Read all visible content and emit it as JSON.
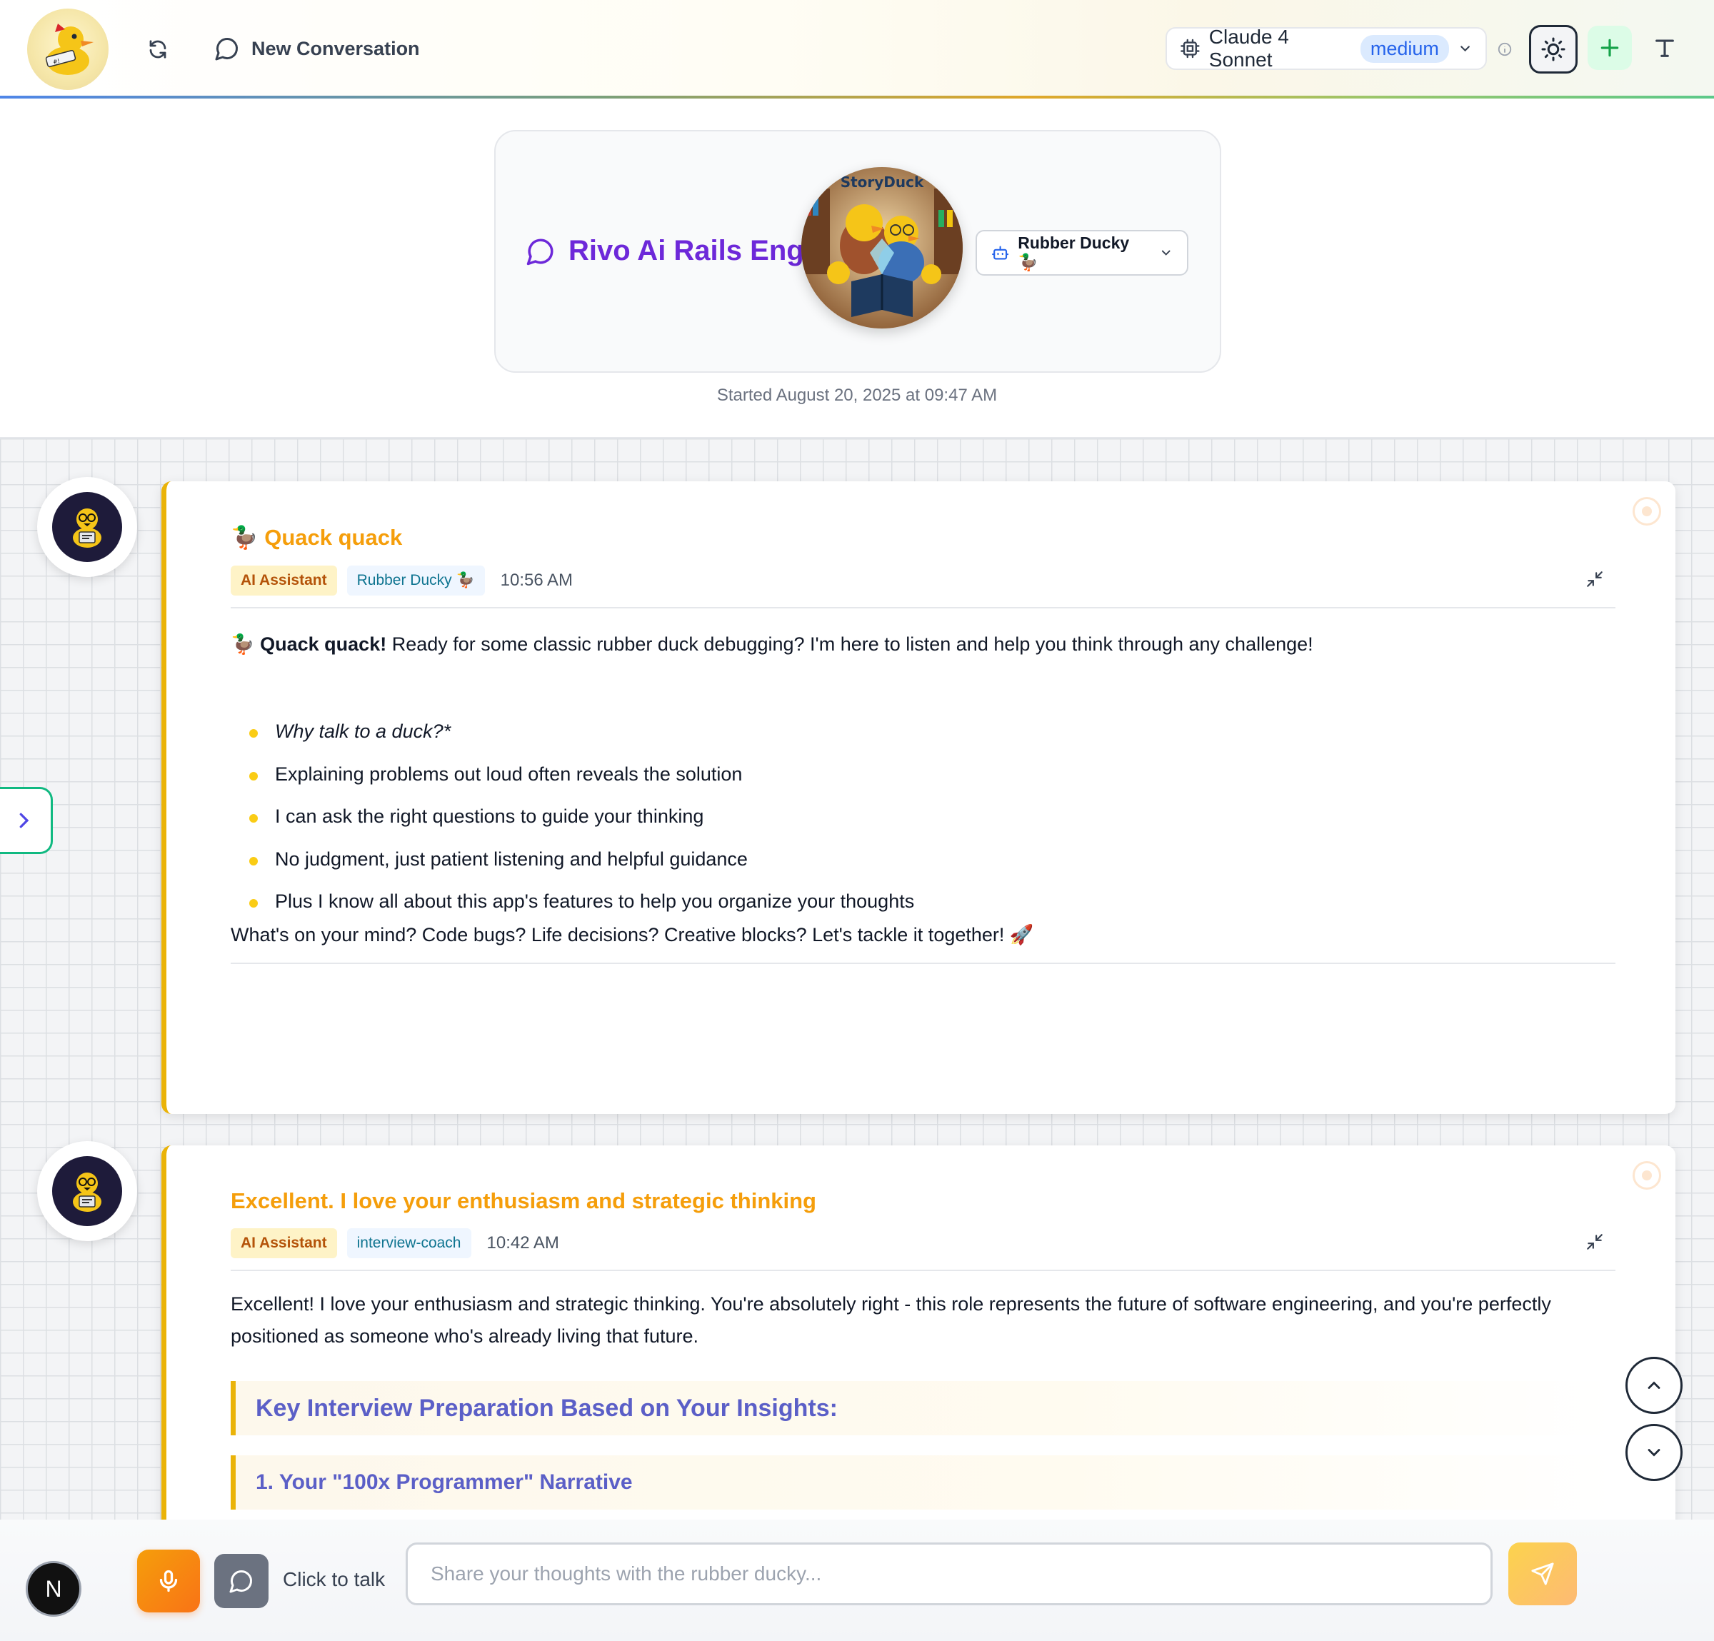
{
  "header": {
    "new_conversation_label": "New Conversation",
    "model_name": "Claude 4 Sonnet",
    "model_effort": "medium"
  },
  "conversation": {
    "title": "Rivo Ai Rails Eng",
    "avatar_label": "StoryDuck",
    "persona_selected": "Rubber Ducky 🦆",
    "started": "Started August 20, 2025 at 09:47 AM"
  },
  "messages": [
    {
      "title": "🦆 Quack quack",
      "role_tag": "AI Assistant",
      "persona_tag": "Rubber Ducky 🦆",
      "time": "10:56 AM",
      "intro_bold": "Quack quack!",
      "intro_emoji": "🦆",
      "intro_rest": " Ready for some classic rubber duck debugging? I'm here to listen and help you think through any challenge!",
      "bullets": [
        "Why talk to a duck?*",
        "Explaining problems out loud often reveals the solution",
        "I can ask the right questions to guide your thinking",
        "No judgment, just patient listening and helpful guidance",
        "Plus I know all about this app's features to help you organize your thoughts"
      ],
      "outro": "What's on your mind? Code bugs? Life decisions? Creative blocks? Let's tackle it together! 🚀"
    },
    {
      "title": "Excellent. I love your enthusiasm and strategic thinking",
      "role_tag": "AI Assistant",
      "persona_tag": "interview-coach",
      "time": "10:42 AM",
      "body": "Excellent! I love your enthusiasm and strategic thinking. You're absolutely right - this role represents the future of software engineering, and you're perfectly positioned as someone who's already living that future.",
      "heading_1": "Key Interview Preparation Based on Your Insights:",
      "heading_2": "1. Your \"100x Programmer\" Narrative"
    }
  ],
  "footer": {
    "user_initial": "N",
    "click_to_talk": "Click to talk",
    "input_placeholder": "Share your thoughts with the rubber ducky...",
    "input_value": ""
  },
  "colors": {
    "accent_yellow": "#eab308",
    "title_orange": "#f59e0b",
    "conversation_title": "#6d28d9",
    "model_badge_bg": "#dbeafe",
    "model_badge_text": "#2563eb",
    "toggle_green": "#10b981"
  },
  "icons": [
    "logo-duck",
    "refresh-icon",
    "chat-bubble-icon",
    "cpu-chip-icon",
    "chevron-down-icon",
    "info-icon",
    "sun-icon",
    "plus-icon",
    "font-icon",
    "bot-icon",
    "collapse-icon",
    "chevron-right-icon",
    "chevron-up-icon",
    "mic-icon",
    "send-icon"
  ]
}
